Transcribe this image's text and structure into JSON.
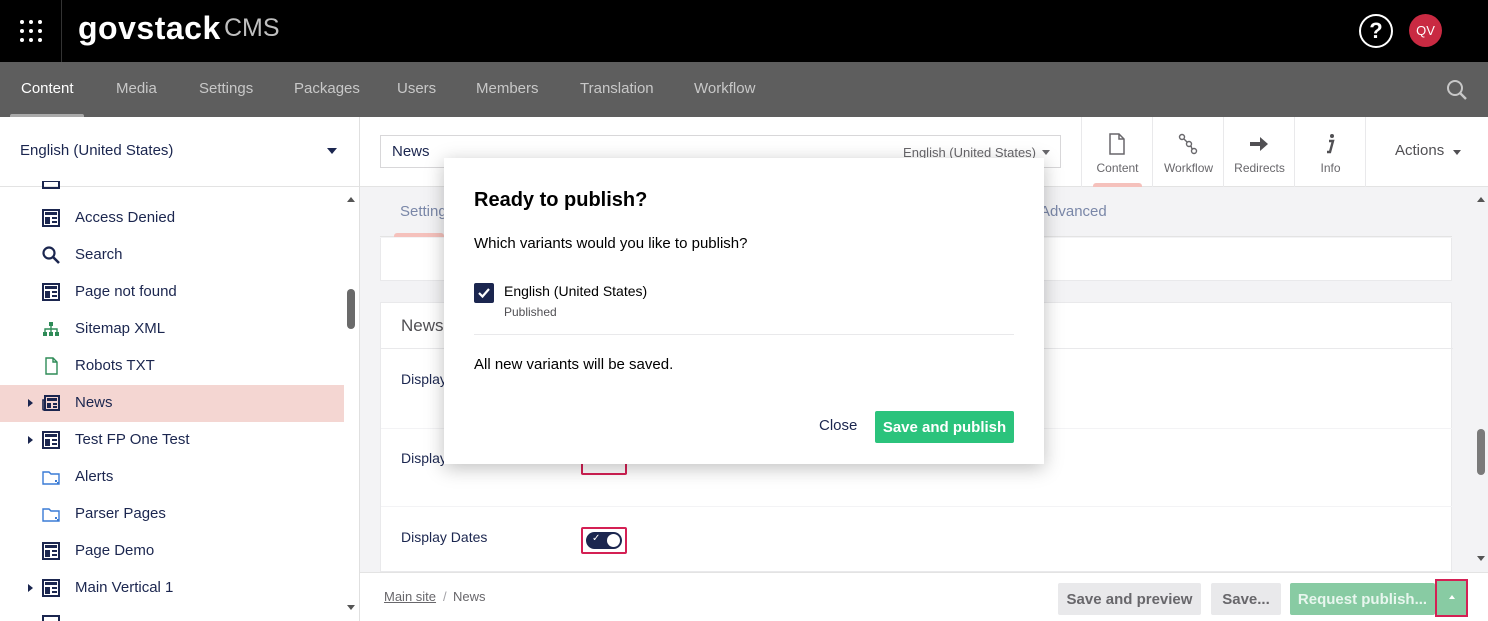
{
  "header": {
    "brand": "govstack",
    "brand_suffix": "CMS",
    "help_icon": "question-circle-icon",
    "user_initials": "QV"
  },
  "sections": [
    {
      "label": "Content",
      "active": true
    },
    {
      "label": "Media"
    },
    {
      "label": "Settings"
    },
    {
      "label": "Packages"
    },
    {
      "label": "Users"
    },
    {
      "label": "Members"
    },
    {
      "label": "Translation"
    },
    {
      "label": "Workflow"
    }
  ],
  "tree": {
    "language": "English (United States)",
    "items": [
      {
        "label": "Access Denied",
        "icon": "page-layout-icon"
      },
      {
        "label": "Search",
        "icon": "search-icon"
      },
      {
        "label": "Page not found",
        "icon": "page-layout-icon"
      },
      {
        "label": "Sitemap XML",
        "icon": "sitemap-icon"
      },
      {
        "label": "Robots TXT",
        "icon": "document-icon"
      },
      {
        "label": "News",
        "icon": "newspaper-icon",
        "selected": true,
        "expandable": true
      },
      {
        "label": "Test FP One Test",
        "icon": "page-layout-icon",
        "expandable": true
      },
      {
        "label": "Alerts",
        "icon": "folder-icon"
      },
      {
        "label": "Parser Pages",
        "icon": "folder-icon"
      },
      {
        "label": "Page Demo",
        "icon": "page-layout-icon"
      },
      {
        "label": "Main Vertical 1",
        "icon": "page-layout-icon",
        "expandable": true
      }
    ]
  },
  "editor": {
    "name": "News",
    "variant": "English (United States)",
    "apps": [
      {
        "label": "Content",
        "icon": "document-icon",
        "active": true
      },
      {
        "label": "Workflow",
        "icon": "workflow-icon"
      },
      {
        "label": "Redirects",
        "icon": "arrow-right-icon"
      },
      {
        "label": "Info",
        "icon": "info-icon"
      }
    ],
    "actions_label": "Actions",
    "tabs": [
      "Setting",
      "Advanced"
    ],
    "panel_title": "News",
    "props": [
      "Display",
      "Display",
      "Display Dates"
    ]
  },
  "footer": {
    "breadcrumb_root": "Main site",
    "breadcrumb_sep": "/",
    "breadcrumb_current": "News",
    "save_preview": "Save and preview",
    "save": "Save...",
    "request_publish": "Request publish..."
  },
  "dialog": {
    "title": "Ready to publish?",
    "question": "Which variants would you like to publish?",
    "variant_name": "English (United States)",
    "variant_state": "Published",
    "variant_checked": true,
    "note": "All new variants will be saved.",
    "close_label": "Close",
    "publish_label": "Save and publish"
  },
  "colors": {
    "header_bg": "#000000",
    "sections_bg": "#5e5e5e",
    "selected_tree": "#f4d6d2",
    "primary_green": "#2bc37c",
    "navy": "#1b264f",
    "highlight_red": "#d42054"
  }
}
